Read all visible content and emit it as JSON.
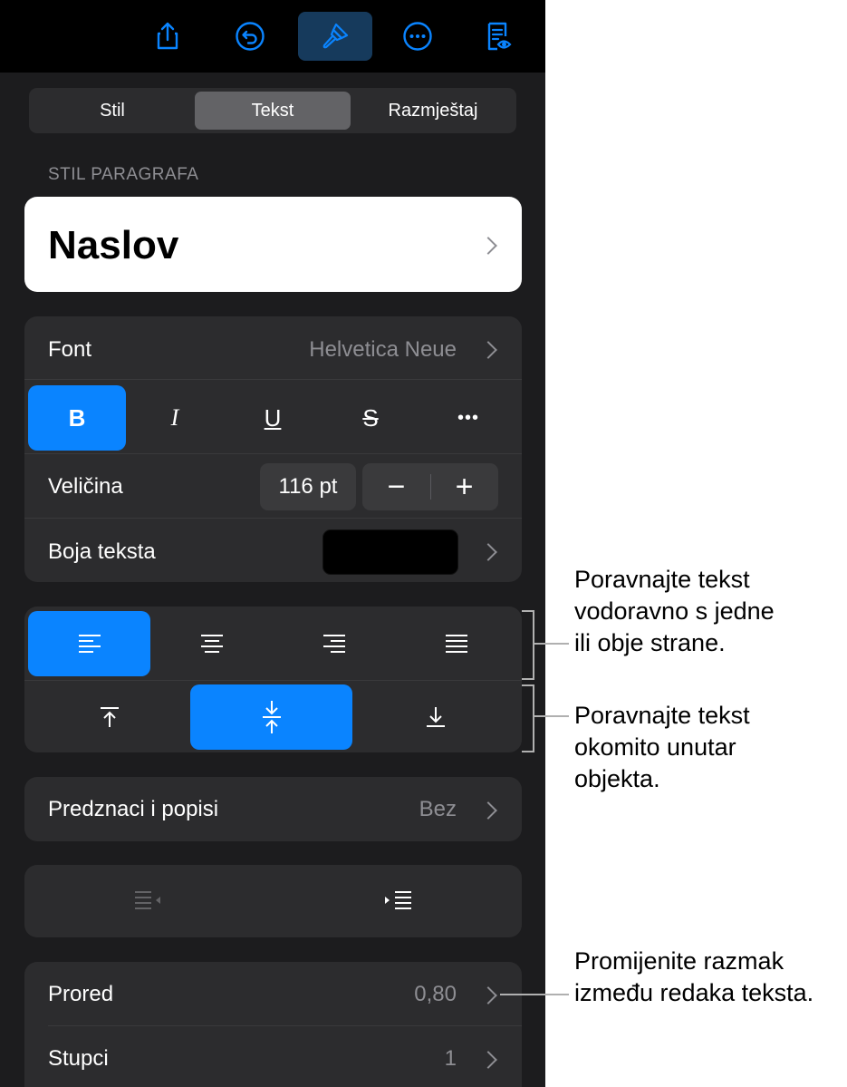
{
  "toolbar": {
    "icons": [
      "share-icon",
      "undo-icon",
      "paintbrush-icon",
      "more-icon",
      "reader-view-icon"
    ],
    "active": "paintbrush-icon"
  },
  "tabs": [
    {
      "label": "Stil",
      "active": false
    },
    {
      "label": "Tekst",
      "active": true
    },
    {
      "label": "Razmještaj",
      "active": false
    }
  ],
  "paragraph_style": {
    "section_label": "STIL PARAGRAFA",
    "value": "Naslov"
  },
  "font_group": {
    "font_label": "Font",
    "font_value": "Helvetica Neue",
    "buttons": [
      {
        "label": "B",
        "active": true
      },
      {
        "label": "I",
        "active": false
      },
      {
        "label": "U",
        "active": false
      },
      {
        "label": "S",
        "active": false
      },
      {
        "label": "•••",
        "active": false
      }
    ],
    "size_label": "Veličina",
    "size_value": "116 pt",
    "minus": "−",
    "plus": "+",
    "color_label": "Boja teksta",
    "color_value": "#000000"
  },
  "alignment": {
    "horizontal": [
      "align-left",
      "align-center",
      "align-right",
      "justify"
    ],
    "horizontal_active": "align-left",
    "vertical": [
      "align-top",
      "align-middle",
      "align-bottom"
    ],
    "vertical_active": "align-middle"
  },
  "bullets": {
    "label": "Predznaci i popisi",
    "value": "Bez"
  },
  "indent": {
    "decrease_enabled": false,
    "increase_enabled": true
  },
  "spacing": {
    "label": "Prored",
    "value": "0,80"
  },
  "columns": {
    "label": "Stupci",
    "value": "1"
  },
  "callouts": {
    "horizontal": [
      "Poravnajte tekst",
      "vodoravno s jedne",
      "ili obje strane."
    ],
    "vertical": [
      "Poravnajte tekst",
      "okomito unutar",
      "objekta."
    ],
    "spacing": [
      "Promijenite razmak",
      "između redaka teksta."
    ]
  },
  "colors": {
    "accent": "#0a84ff",
    "panel": "#1c1c1e",
    "group": "#2c2c2e"
  }
}
